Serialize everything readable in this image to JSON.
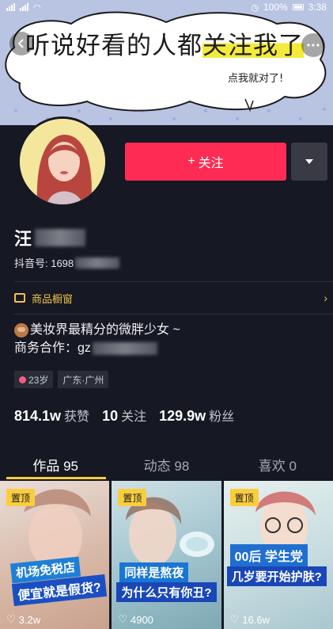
{
  "status_bar": {
    "battery": "100%",
    "time": "3:38"
  },
  "banner": {
    "headline_pre": "听说好看的人都",
    "headline_highlight": "关注我了",
    "subtext": "点我就对了!"
  },
  "profile": {
    "follow_label": "关注",
    "follow_plus": "+",
    "name_visible": "汪",
    "id_label": "抖音号: 1698",
    "shop_label": "商品橱窗",
    "bio_line1": "美妆界最精分的微胖少女 ~",
    "bio_line2": "商务合作：gz",
    "tags": [
      {
        "label": "23岁"
      },
      {
        "label": "广东·广州"
      }
    ],
    "stats": [
      {
        "num": "814.1w",
        "label": "获赞"
      },
      {
        "num": "10",
        "label": "关注"
      },
      {
        "num": "129.9w",
        "label": "粉丝"
      }
    ]
  },
  "tabs": [
    {
      "label": "作品 95"
    },
    {
      "label": "动态 98"
    },
    {
      "label": "喜欢 0"
    }
  ],
  "videos": [
    {
      "pin": "置顶",
      "caption1": "机场免税店",
      "caption2": "便宜就是假货?",
      "likes": "3.2w"
    },
    {
      "pin": "置顶",
      "caption1": "同样是熬夜",
      "caption2": "为什么只有你丑?",
      "likes": "4900"
    },
    {
      "pin": "置顶",
      "caption1": "00后 学生党",
      "caption2": "几岁要开始护肤?",
      "likes": "16.6w"
    }
  ],
  "colors": {
    "accent_red": "#fe2c55",
    "accent_yellow": "#facd3c",
    "background": "#161823"
  }
}
